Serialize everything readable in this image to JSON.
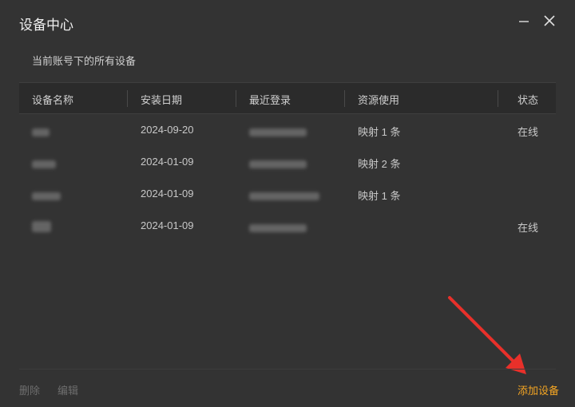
{
  "window": {
    "title": "设备中心"
  },
  "subtitle": "当前账号下的所有设备",
  "table": {
    "headers": [
      "设备名称",
      "安装日期",
      "最近登录",
      "资源使用",
      "状态"
    ],
    "rows": [
      {
        "name": "",
        "install_date": "2024-09-20",
        "last_login": "",
        "resource": "映射 1 条",
        "status": "在线"
      },
      {
        "name": "",
        "install_date": "2024-01-09",
        "last_login": "",
        "resource": "映射 2 条",
        "status": ""
      },
      {
        "name": "",
        "install_date": "2024-01-09",
        "last_login": "",
        "resource": "映射 1 条",
        "status": ""
      },
      {
        "name": "",
        "install_date": "2024-01-09",
        "last_login": "",
        "resource": "",
        "status": "在线"
      }
    ]
  },
  "footer": {
    "delete_label": "删除",
    "edit_label": "编辑",
    "add_label": "添加设备"
  },
  "colors": {
    "background": "#333333",
    "accent": "#f5a623",
    "arrow": "#e8302a"
  },
  "icons": {
    "minimize": "minimize-icon",
    "close": "close-icon",
    "annotation": "red-arrow-icon"
  }
}
